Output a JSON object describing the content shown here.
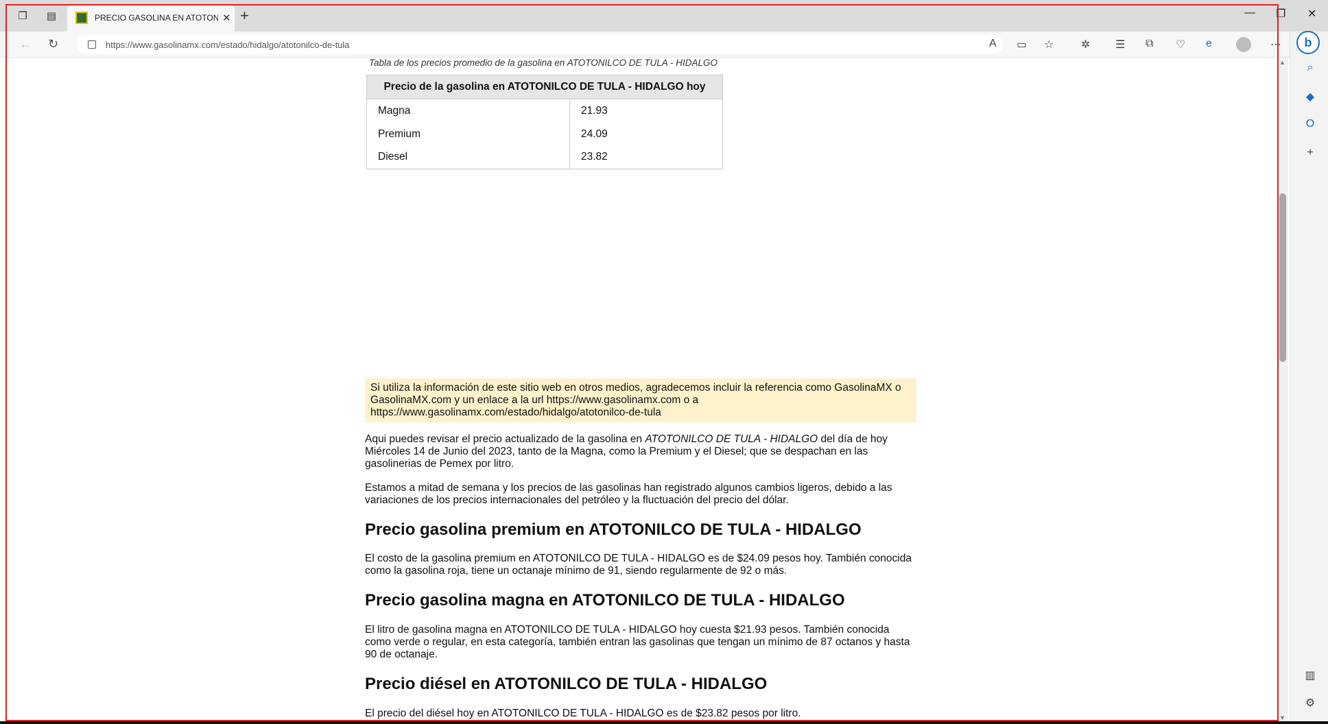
{
  "browser": {
    "tab_title": "PRECIO GASOLINA EN ATOTONILCO DE TULA",
    "url": "https://www.gasolinamx.com/estado/hidalgo/atotonilco-de-tula"
  },
  "table": {
    "caption": "Tabla de los precios promedio de la gasolina en ATOTONILCO DE TULA - HIDALGO",
    "header": "Precio de la gasolina en ATOTONILCO DE TULA - HIDALGO hoy",
    "rows": [
      {
        "fuel": "Magna",
        "price": "21.93"
      },
      {
        "fuel": "Premium",
        "price": "24.09"
      },
      {
        "fuel": "Diesel",
        "price": "23.82"
      }
    ]
  },
  "notice": "Si utiliza la información de este sitio web en otros medios, agradecemos incluir la referencia como GasolinaMX o GasolinaMX.com y un enlace a la url https://www.gasolinamx.com o a https://www.gasolinamx.com/estado/hidalgo/atotonilco-de-tula",
  "intro": {
    "p1_before": "Aqui puedes revisar el precio actualizado de la gasolina en ",
    "p1_italic": "ATOTONILCO DE TULA - HIDALGO",
    "p1_after": " del día de hoy Miércoles 14 de Junio del 2023, tanto de la Magna, como la Premium y el Diesel; que se despachan en las gasolinerias de Pemex por litro.",
    "p2": "Estamos a mitad de semana y los precios de las gasolinas han registrado algunos cambios ligeros, debido a las variaciones de los precios internacionales del petróleo y la fluctuación del precio del dólar."
  },
  "sections": [
    {
      "heading": "Precio gasolina premium en ATOTONILCO DE TULA - HIDALGO",
      "text": "El costo de la gasolina premium en ATOTONILCO DE TULA - HIDALGO es de $24.09 pesos hoy. También conocida como la gasolina roja, tiene un octanaje mínimo de 91, siendo regularmente de 92 o más."
    },
    {
      "heading": "Precio gasolina magna en ATOTONILCO DE TULA - HIDALGO",
      "text": "El litro de gasolina magna en ATOTONILCO DE TULA - HIDALGO hoy cuesta $21.93 pesos. También conocida como verde o regular, en esta categoría, también entran las gasolinas que tengan un mínimo de 87 octanos y hasta 90 de octanaje."
    },
    {
      "heading": "Precio diésel en ATOTONILCO DE TULA - HIDALGO",
      "text": "El precio del diésel hoy en ATOTONILCO DE TULA - HIDALGO es de $23.82 pesos por litro."
    }
  ]
}
